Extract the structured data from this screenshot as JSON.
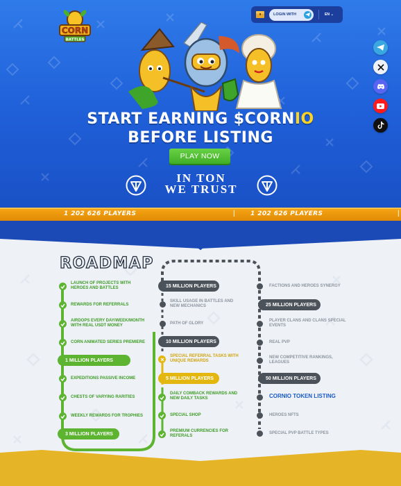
{
  "header": {
    "login_label": "LOGIN WITH",
    "language": "EN",
    "language_arrow": "⌄"
  },
  "social_icons": [
    "telegram-icon",
    "x-icon",
    "discord-icon",
    "youtube-icon",
    "tiktok-icon"
  ],
  "hero": {
    "title_line1_prefix": "START EARNING $CORN",
    "title_line1_accent": "IO",
    "title_line2": "BEFORE LISTING",
    "play_label": "PLAY NOW",
    "ton_line1": "IN TON",
    "ton_line2": "WE TRUST"
  },
  "players_strip": {
    "left": "1 202 626 PLAYERS",
    "right": "1 202 626 PLAYERS"
  },
  "roadmap": {
    "title": "ROADMAP",
    "col1": [
      {
        "type": "item",
        "text1": "LAUNCH OF PROJECTS WITH",
        "text2": "HEROES AND BATTLES"
      },
      {
        "type": "item",
        "text1": "REWARDS FOR REFERRALS",
        "text2": ""
      },
      {
        "type": "item",
        "text1": "AIRDOPS EVERY DAY/WEEK/MONTH",
        "text2": "WITH REAL USDT MONEY"
      },
      {
        "type": "item",
        "text1": "CORN ANIMATED SERIES PREMIERE",
        "text2": ""
      },
      {
        "type": "pill",
        "text1": "1 MILLION PLAYERS"
      },
      {
        "type": "item",
        "text1": "EXPEDITIONS PASSIVE INCOME",
        "text2": ""
      },
      {
        "type": "item",
        "text1": "CHESTS OF VARYING RARITIES",
        "text2": ""
      },
      {
        "type": "item",
        "text1": "WEEKLY REWARDS FOR TROPHIES",
        "text2": ""
      },
      {
        "type": "pill",
        "text1": "3 MILLION PLAYERS"
      }
    ],
    "col2": [
      {
        "type": "pill",
        "text1": "15 MILLION PLAYERS"
      },
      {
        "type": "item",
        "text1": "SKILL USAGE IN BATTLES AND",
        "text2": "NEW MECHANICS"
      },
      {
        "type": "item",
        "text1": "PATH OF GLORY",
        "text2": ""
      },
      {
        "type": "pill",
        "text1": "10 MILLION PLAYERS"
      },
      {
        "type": "item",
        "text1": "SPECIAL REFERRAL TASKS WITH",
        "text2": "UNIQUE REWARDS"
      },
      {
        "type": "pill",
        "text1": "5 MILLION PLAYERS"
      },
      {
        "type": "item",
        "text1": "DAILY COMBACK REWARDS AND",
        "text2": "NEW DAILY TASKS"
      },
      {
        "type": "item",
        "text1": "SPECIAL SHOP",
        "text2": ""
      },
      {
        "type": "item",
        "text1": "PREMIUM CURRENCIES FOR",
        "text2": "REFERALS"
      }
    ],
    "col3": [
      {
        "type": "item",
        "text1": "FACTIONS AND HEROES SYNERGY",
        "text2": ""
      },
      {
        "type": "pill",
        "text1": "25 MILLION PLAYERS"
      },
      {
        "type": "item",
        "text1": "PLAYER CLANS AND CLANS SPECIAL",
        "text2": "EVENTS"
      },
      {
        "type": "item",
        "text1": "REAL PVP",
        "text2": ""
      },
      {
        "type": "item",
        "text1": "NEW COMPETITIVE RANKINGS,",
        "text2": "LEAGUES"
      },
      {
        "type": "pill",
        "text1": "50 MILLION PLAYERS"
      },
      {
        "type": "item",
        "text1": "CORNIO TOKEN LISTING",
        "text2": ""
      },
      {
        "type": "item",
        "text1": "HEROES NFTS",
        "text2": ""
      },
      {
        "type": "item",
        "text1": "SPECIAL PVP BATTLE TYPES",
        "text2": ""
      }
    ]
  },
  "colors": {
    "hero_blue": "#1f5fd8",
    "accent_yellow": "#ffd21f",
    "done_green": "#5db431",
    "current_gold": "#e3b70f",
    "pending_gray": "#4b525a",
    "token_blue": "#1959c7",
    "strip_orange": "#f5a313"
  }
}
